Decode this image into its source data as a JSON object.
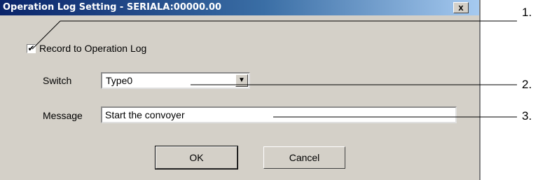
{
  "dialog": {
    "title": "Operation Log Setting - SERIALA:00000.00",
    "close_label": "x"
  },
  "record": {
    "checked": true,
    "check_mark": "✔",
    "label": "Record to Operation Log"
  },
  "switch": {
    "label": "Switch",
    "value": "Type0",
    "dropdown_glyph": "▼"
  },
  "message": {
    "label": "Message",
    "value": "Start the convoyer"
  },
  "buttons": {
    "ok": "OK",
    "cancel": "Cancel"
  },
  "callouts": [
    "1.",
    "2.",
    "3."
  ]
}
